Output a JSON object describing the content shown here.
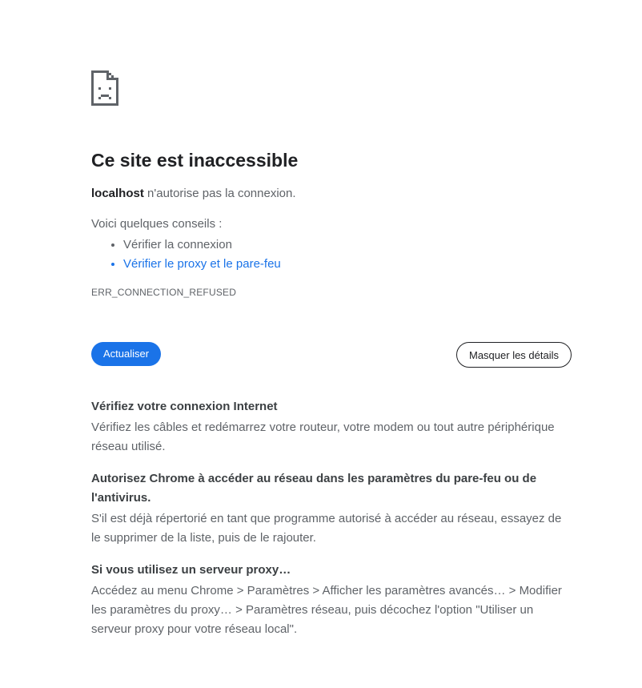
{
  "error_page": {
    "title": "Ce site est inaccessible",
    "summary": {
      "host": "localhost",
      "message": " n'autorise pas la connexion."
    },
    "tips_intro": "Voici quelques conseils :",
    "tips": [
      "Vérifier la connexion",
      "Vérifier le proxy et le pare-feu"
    ],
    "error_code": "ERR_CONNECTION_REFUSED",
    "buttons": {
      "reload": "Actualiser",
      "details_toggle": "Masquer les détails"
    },
    "details": [
      {
        "title": "Vérifiez votre connexion Internet",
        "body": "Vérifiez les câbles et redémarrez votre routeur, votre modem ou tout autre périphérique réseau utilisé."
      },
      {
        "title": "Autorisez Chrome à accéder au réseau dans les paramètres du pare-feu ou de l'antivirus.",
        "body": "S'il est déjà répertorié en tant que programme autorisé à accéder au réseau, essayez de le supprimer de la liste, puis de le rajouter."
      },
      {
        "title": "Si vous utilisez un serveur proxy…",
        "body": "Accédez au menu Chrome > Paramètres > Afficher les paramètres avancés… > Modifier les paramètres du proxy… > Paramètres réseau, puis décochez l'option \"Utiliser un serveur proxy pour votre réseau local\"."
      }
    ],
    "icon": "sad-page-icon",
    "colors": {
      "accent": "#1a73e8",
      "text": "#202124",
      "secondary_text": "#5f6368"
    }
  }
}
